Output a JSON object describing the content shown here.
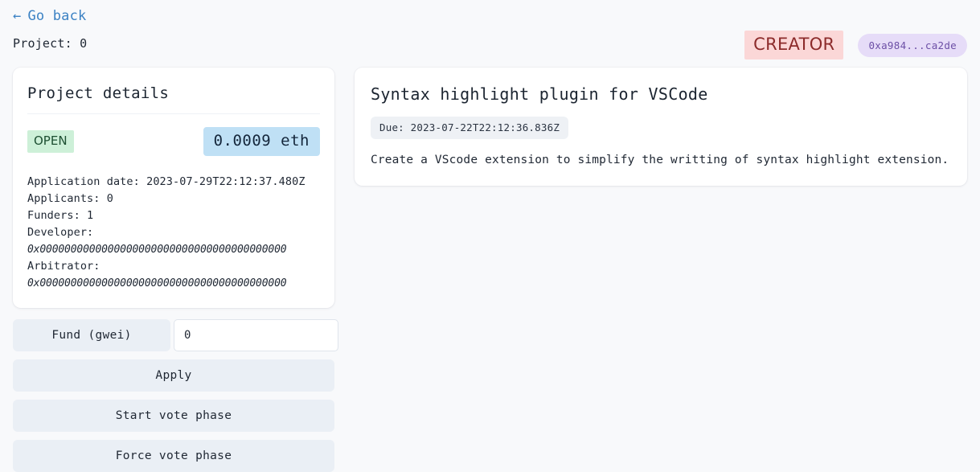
{
  "header": {
    "back_arrow": "←",
    "back_label": "Go back",
    "project_line": "Project: 0",
    "creator_badge": "CREATOR",
    "address_pill": "0xa984...ca2de"
  },
  "details": {
    "title": "Project details",
    "status": "OPEN",
    "amount": "0.0009 eth",
    "application_date": "Application date: 2023-07-29T22:12:37.480Z",
    "applicants": "Applicants: 0",
    "funders": "Funders: 1",
    "developer_label": "Developer:",
    "developer_address": "0x0000000000000000000000000000000000000000",
    "arbitrator_label": "Arbitrator:",
    "arbitrator_address": "0x0000000000000000000000000000000000000000"
  },
  "actions": {
    "fund_label": "Fund (gwei)",
    "fund_value": "0",
    "apply_label": "Apply",
    "start_vote_label": "Start vote phase",
    "force_vote_label": "Force vote phase"
  },
  "task": {
    "title": "Syntax highlight plugin for VSCode",
    "due": "Due: 2023-07-22T22:12:36.836Z",
    "description": "Create a VScode extension to simplify the writting of syntax highlight extension."
  },
  "colors": {
    "page_bg": "#f8f9fb",
    "link": "#3c82c4",
    "creator_bg": "#fbd7d7",
    "creator_text": "#8c2b2b",
    "address_bg": "#e6dcf8",
    "address_text": "#6c4fa6",
    "open_bg": "#cdf0d8",
    "open_text": "#1d4f32",
    "amount_bg": "#bfe0f5",
    "button_bg": "#eaeff5"
  }
}
